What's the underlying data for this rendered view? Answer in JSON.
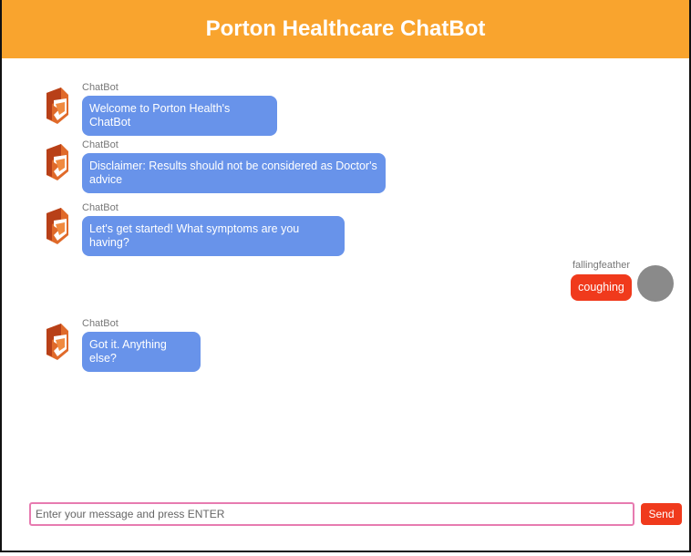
{
  "header": {
    "title": "Porton Healthcare ChatBot"
  },
  "messages": [
    {
      "sender": "ChatBot",
      "text": "Welcome to Porton Health's ChatBot",
      "from": "bot"
    },
    {
      "sender": "ChatBot",
      "text": "Disclaimer: Results should not be considered as Doctor's advice",
      "from": "bot"
    },
    {
      "sender": "ChatBot",
      "text": "Let's get started! What symptoms are you having?",
      "from": "bot"
    },
    {
      "sender": "fallingfeather",
      "text": "coughing",
      "from": "user"
    },
    {
      "sender": "ChatBot",
      "text": "Got it. Anything else?",
      "from": "bot"
    }
  ],
  "composer": {
    "placeholder": "Enter your message and press ENTER",
    "send_label": "Send"
  },
  "colors": {
    "header": "#f9a42e",
    "bot_bubble": "#6893ea",
    "user_bubble": "#f03a1c",
    "input_border": "#e77bb0",
    "send_button": "#f03a1c"
  },
  "icons": {
    "bot_avatar": "porton-logo-icon",
    "user_avatar": "user-avatar-icon"
  }
}
